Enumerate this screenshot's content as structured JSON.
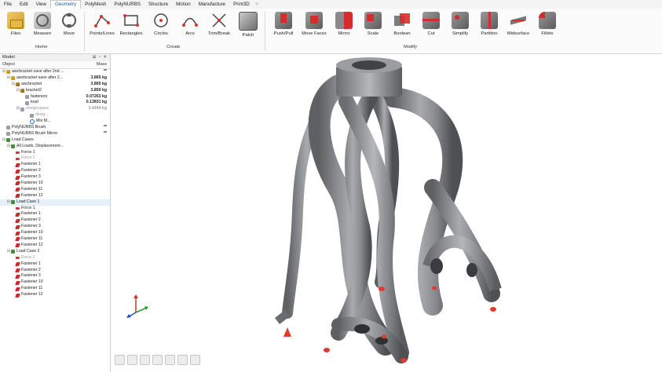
{
  "menu": [
    "File",
    "Edit",
    "View",
    "Geometry",
    "PolyMesh",
    "PolyNURBS",
    "Structure",
    "Motion",
    "Manufacture",
    "Print3D"
  ],
  "active_menu_index": 3,
  "ribbon": {
    "buttons": [
      {
        "label": "Files",
        "icon": "files-icon"
      },
      {
        "label": "Measure",
        "icon": "measure-icon"
      },
      {
        "label": "Move",
        "icon": "move-icon"
      },
      {
        "label": "Points/Lines",
        "icon": "points-lines-icon"
      },
      {
        "label": "Rectangles",
        "icon": "rectangles-icon"
      },
      {
        "label": "Circles",
        "icon": "circles-icon"
      },
      {
        "label": "Arcs",
        "icon": "arcs-icon"
      },
      {
        "label": "Trim/Break",
        "icon": "trim-break-icon"
      },
      {
        "label": "Patch",
        "icon": "patch-icon"
      },
      {
        "label": "Push/Pull",
        "icon": "push-pull-icon"
      },
      {
        "label": "Move Faces",
        "icon": "move-faces-icon"
      },
      {
        "label": "Mirror",
        "icon": "mirror-icon"
      },
      {
        "label": "Scale",
        "icon": "scale-icon"
      },
      {
        "label": "Boolean",
        "icon": "boolean-icon"
      },
      {
        "label": "Cut",
        "icon": "cut-icon"
      },
      {
        "label": "Simplify",
        "icon": "simplify-icon"
      },
      {
        "label": "Partition",
        "icon": "partition-icon"
      },
      {
        "label": "Midsurface",
        "icon": "midsurface-icon"
      },
      {
        "label": "Fillets",
        "icon": "fillets-icon"
      }
    ],
    "groups": [
      "Home",
      "Create",
      "Modify"
    ]
  },
  "model_panel": {
    "title": "Model",
    "col_object": "Object",
    "col_mass": "Mass",
    "rows": [
      {
        "label": "awcbracket save after 2nd ...",
        "value": "**"
      },
      {
        "label": "awcbracket save after 2...",
        "value": "3.865 kg"
      },
      {
        "label": "awcbracket",
        "value": "3.865 kg"
      },
      {
        "label": "bracket2",
        "value": "3.859 kg"
      },
      {
        "label": "fasteners",
        "value": "0.07263 kg"
      },
      {
        "label": "load",
        "value": "0.13831 kg"
      },
      {
        "label": "designspace",
        "value": "3.4444 kg"
      },
      {
        "label": "desig...",
        "value": ""
      },
      {
        "label": "Min M...",
        "value": ""
      },
      {
        "label": "PolyNURBS Brush",
        "value": "**"
      },
      {
        "label": "PolyNURBS Brush Mirror",
        "value": "**"
      },
      {
        "label": "Load Cases",
        "value": ""
      },
      {
        "label": "All Loads, Displacement...",
        "value": ""
      },
      {
        "label": "Force 1",
        "value": ""
      },
      {
        "label": "Force 2",
        "value": ""
      },
      {
        "label": "Fastener 1",
        "value": ""
      },
      {
        "label": "Fastener 2",
        "value": ""
      },
      {
        "label": "Fastener 3",
        "value": ""
      },
      {
        "label": "Fastener 10",
        "value": ""
      },
      {
        "label": "Fastener 11",
        "value": ""
      },
      {
        "label": "Fastener 12",
        "value": ""
      },
      {
        "label": "Load Case 1",
        "value": ""
      },
      {
        "label": "Force 1",
        "value": ""
      },
      {
        "label": "Fastener 1",
        "value": ""
      },
      {
        "label": "Fastener 2",
        "value": ""
      },
      {
        "label": "Fastener 3",
        "value": ""
      },
      {
        "label": "Fastener 10",
        "value": ""
      },
      {
        "label": "Fastener 11",
        "value": ""
      },
      {
        "label": "Fastener 12",
        "value": ""
      },
      {
        "label": "Load Case 2",
        "value": ""
      },
      {
        "label": "Force 2",
        "value": ""
      },
      {
        "label": "Fastener 1",
        "value": ""
      },
      {
        "label": "Fastener 2",
        "value": ""
      },
      {
        "label": "Fastener 3",
        "value": ""
      },
      {
        "label": "Fastener 10",
        "value": ""
      },
      {
        "label": "Fastener 11",
        "value": ""
      },
      {
        "label": "Fastener 12",
        "value": ""
      }
    ]
  },
  "colors": {
    "accent": "#1a5fa8",
    "model_gray": "#7d7f82",
    "fastener_red": "#e23b2e"
  }
}
